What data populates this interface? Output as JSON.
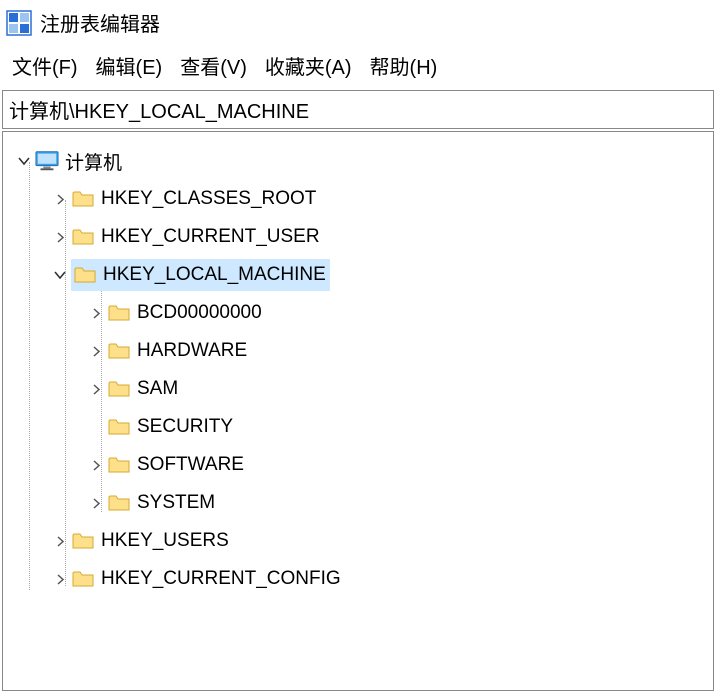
{
  "titlebar": {
    "app_title": "注册表编辑器"
  },
  "menubar": {
    "file": "文件(F)",
    "edit": "编辑(E)",
    "view": "查看(V)",
    "favorites": "收藏夹(A)",
    "help": "帮助(H)"
  },
  "addressbar": {
    "path": "计算机\\HKEY_LOCAL_MACHINE"
  },
  "tree": {
    "root": {
      "label": "计算机",
      "expanded": true,
      "children": [
        {
          "label": "HKEY_CLASSES_ROOT",
          "expanded": false
        },
        {
          "label": "HKEY_CURRENT_USER",
          "expanded": false
        },
        {
          "label": "HKEY_LOCAL_MACHINE",
          "expanded": true,
          "selected": true,
          "children": [
            {
              "label": "BCD00000000",
              "expanded": false
            },
            {
              "label": "HARDWARE",
              "expanded": false
            },
            {
              "label": "SAM",
              "expanded": false
            },
            {
              "label": "SECURITY",
              "leaf": true
            },
            {
              "label": "SOFTWARE",
              "expanded": false
            },
            {
              "label": "SYSTEM",
              "expanded": false
            }
          ]
        },
        {
          "label": "HKEY_USERS",
          "expanded": false
        },
        {
          "label": "HKEY_CURRENT_CONFIG",
          "expanded": false
        }
      ]
    }
  }
}
